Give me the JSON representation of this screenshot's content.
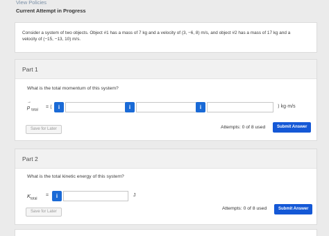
{
  "header": {
    "link": "View Policies",
    "section_title": "Current Attempt in Progress"
  },
  "problem": {
    "line1": "Consider a system of two objects. Object #1 has a mass of 7 kg and a velocity of (3, −6, 8) m/s, and object #2 has a mass of 17 kg and a",
    "line2": "velocity of (−15, −13, 10) m/s."
  },
  "part1": {
    "title": "Part 1",
    "question": "What is the total momentum of this system?",
    "symbol": "p",
    "symbol_sub": "total",
    "equals_open": "= ⟨",
    "sep": ",",
    "close_unit": "⟩ kg·m/s",
    "info_label": "i",
    "save_label": "Save for Later",
    "attempts": "Attempts: 0 of 8 used",
    "submit_label": "Submit Answer",
    "inputs": [
      "",
      "",
      ""
    ]
  },
  "part2": {
    "title": "Part 2",
    "question": "What is the total kinetic energy of this system?",
    "symbol": "K",
    "symbol_sub": "total",
    "equals": "=",
    "unit": "J",
    "info_label": "i",
    "save_label": "Save for Later",
    "attempts": "Attempts: 0 of 8 used",
    "submit_label": "Submit Answer",
    "input": ""
  }
}
